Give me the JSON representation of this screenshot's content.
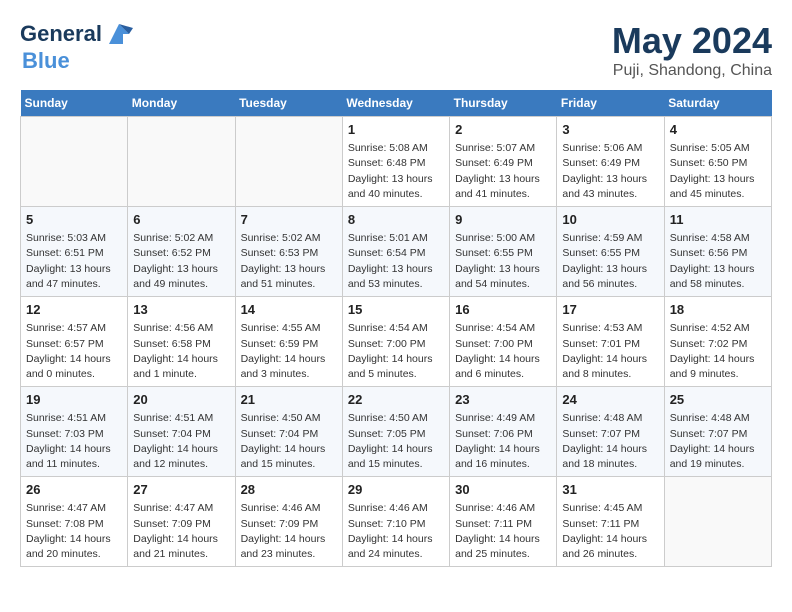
{
  "header": {
    "logo_line1": "General",
    "logo_line2": "Blue",
    "month": "May 2024",
    "location": "Puji, Shandong, China"
  },
  "days_of_week": [
    "Sunday",
    "Monday",
    "Tuesday",
    "Wednesday",
    "Thursday",
    "Friday",
    "Saturday"
  ],
  "weeks": [
    [
      {
        "num": "",
        "info": ""
      },
      {
        "num": "",
        "info": ""
      },
      {
        "num": "",
        "info": ""
      },
      {
        "num": "1",
        "info": "Sunrise: 5:08 AM\nSunset: 6:48 PM\nDaylight: 13 hours\nand 40 minutes."
      },
      {
        "num": "2",
        "info": "Sunrise: 5:07 AM\nSunset: 6:49 PM\nDaylight: 13 hours\nand 41 minutes."
      },
      {
        "num": "3",
        "info": "Sunrise: 5:06 AM\nSunset: 6:49 PM\nDaylight: 13 hours\nand 43 minutes."
      },
      {
        "num": "4",
        "info": "Sunrise: 5:05 AM\nSunset: 6:50 PM\nDaylight: 13 hours\nand 45 minutes."
      }
    ],
    [
      {
        "num": "5",
        "info": "Sunrise: 5:03 AM\nSunset: 6:51 PM\nDaylight: 13 hours\nand 47 minutes."
      },
      {
        "num": "6",
        "info": "Sunrise: 5:02 AM\nSunset: 6:52 PM\nDaylight: 13 hours\nand 49 minutes."
      },
      {
        "num": "7",
        "info": "Sunrise: 5:02 AM\nSunset: 6:53 PM\nDaylight: 13 hours\nand 51 minutes."
      },
      {
        "num": "8",
        "info": "Sunrise: 5:01 AM\nSunset: 6:54 PM\nDaylight: 13 hours\nand 53 minutes."
      },
      {
        "num": "9",
        "info": "Sunrise: 5:00 AM\nSunset: 6:55 PM\nDaylight: 13 hours\nand 54 minutes."
      },
      {
        "num": "10",
        "info": "Sunrise: 4:59 AM\nSunset: 6:55 PM\nDaylight: 13 hours\nand 56 minutes."
      },
      {
        "num": "11",
        "info": "Sunrise: 4:58 AM\nSunset: 6:56 PM\nDaylight: 13 hours\nand 58 minutes."
      }
    ],
    [
      {
        "num": "12",
        "info": "Sunrise: 4:57 AM\nSunset: 6:57 PM\nDaylight: 14 hours\nand 0 minutes."
      },
      {
        "num": "13",
        "info": "Sunrise: 4:56 AM\nSunset: 6:58 PM\nDaylight: 14 hours\nand 1 minute."
      },
      {
        "num": "14",
        "info": "Sunrise: 4:55 AM\nSunset: 6:59 PM\nDaylight: 14 hours\nand 3 minutes."
      },
      {
        "num": "15",
        "info": "Sunrise: 4:54 AM\nSunset: 7:00 PM\nDaylight: 14 hours\nand 5 minutes."
      },
      {
        "num": "16",
        "info": "Sunrise: 4:54 AM\nSunset: 7:00 PM\nDaylight: 14 hours\nand 6 minutes."
      },
      {
        "num": "17",
        "info": "Sunrise: 4:53 AM\nSunset: 7:01 PM\nDaylight: 14 hours\nand 8 minutes."
      },
      {
        "num": "18",
        "info": "Sunrise: 4:52 AM\nSunset: 7:02 PM\nDaylight: 14 hours\nand 9 minutes."
      }
    ],
    [
      {
        "num": "19",
        "info": "Sunrise: 4:51 AM\nSunset: 7:03 PM\nDaylight: 14 hours\nand 11 minutes."
      },
      {
        "num": "20",
        "info": "Sunrise: 4:51 AM\nSunset: 7:04 PM\nDaylight: 14 hours\nand 12 minutes."
      },
      {
        "num": "21",
        "info": "Sunrise: 4:50 AM\nSunset: 7:04 PM\nDaylight: 14 hours\nand 15 minutes."
      },
      {
        "num": "22",
        "info": "Sunrise: 4:50 AM\nSunset: 7:05 PM\nDaylight: 14 hours\nand 15 minutes."
      },
      {
        "num": "23",
        "info": "Sunrise: 4:49 AM\nSunset: 7:06 PM\nDaylight: 14 hours\nand 16 minutes."
      },
      {
        "num": "24",
        "info": "Sunrise: 4:48 AM\nSunset: 7:07 PM\nDaylight: 14 hours\nand 18 minutes."
      },
      {
        "num": "25",
        "info": "Sunrise: 4:48 AM\nSunset: 7:07 PM\nDaylight: 14 hours\nand 19 minutes."
      }
    ],
    [
      {
        "num": "26",
        "info": "Sunrise: 4:47 AM\nSunset: 7:08 PM\nDaylight: 14 hours\nand 20 minutes."
      },
      {
        "num": "27",
        "info": "Sunrise: 4:47 AM\nSunset: 7:09 PM\nDaylight: 14 hours\nand 21 minutes."
      },
      {
        "num": "28",
        "info": "Sunrise: 4:46 AM\nSunset: 7:09 PM\nDaylight: 14 hours\nand 23 minutes."
      },
      {
        "num": "29",
        "info": "Sunrise: 4:46 AM\nSunset: 7:10 PM\nDaylight: 14 hours\nand 24 minutes."
      },
      {
        "num": "30",
        "info": "Sunrise: 4:46 AM\nSunset: 7:11 PM\nDaylight: 14 hours\nand 25 minutes."
      },
      {
        "num": "31",
        "info": "Sunrise: 4:45 AM\nSunset: 7:11 PM\nDaylight: 14 hours\nand 26 minutes."
      },
      {
        "num": "",
        "info": ""
      }
    ]
  ]
}
